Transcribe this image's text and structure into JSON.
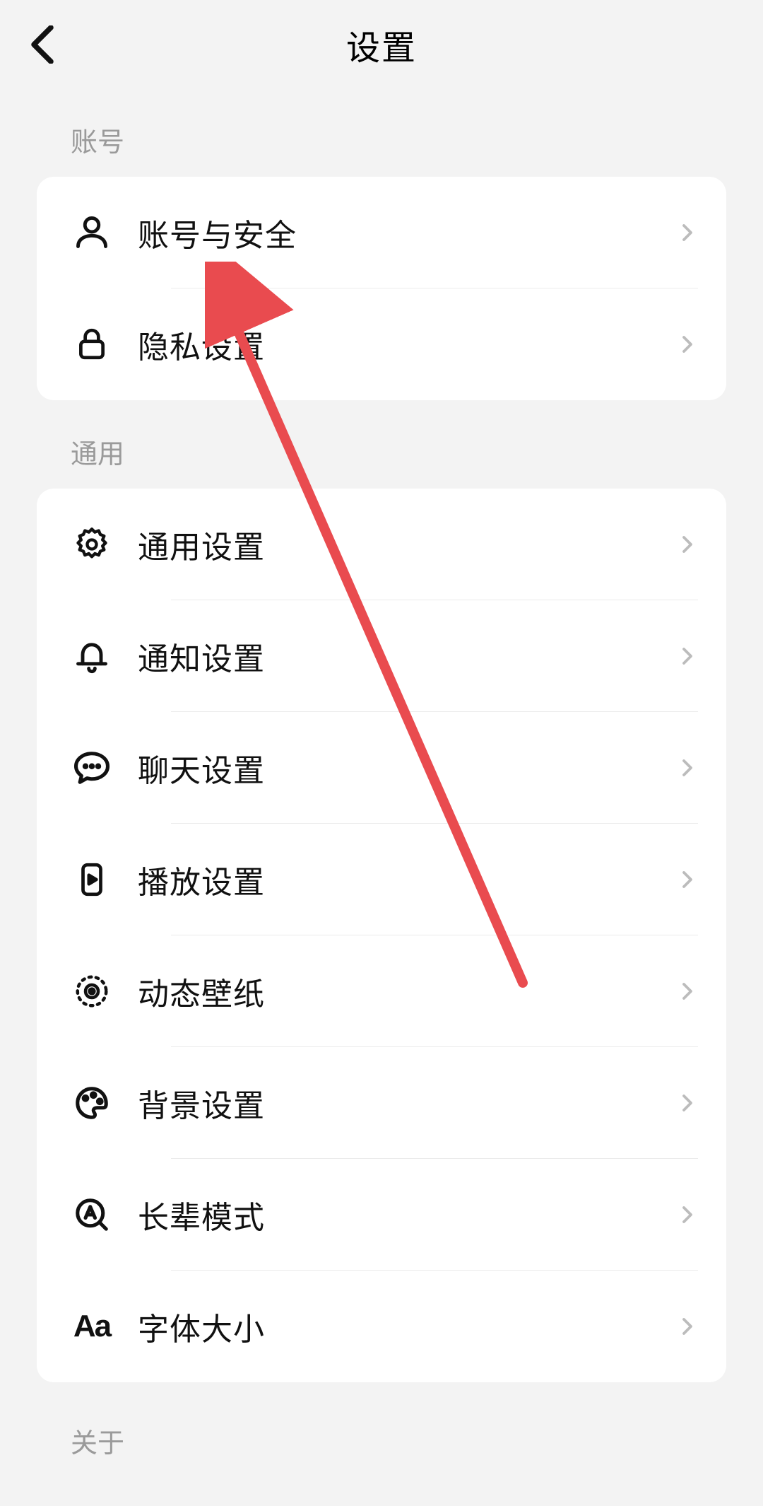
{
  "header": {
    "title": "设置"
  },
  "sections": {
    "account": {
      "label": "账号",
      "items": [
        {
          "label": "账号与安全"
        },
        {
          "label": "隐私设置"
        }
      ]
    },
    "general": {
      "label": "通用",
      "items": [
        {
          "label": "通用设置"
        },
        {
          "label": "通知设置"
        },
        {
          "label": "聊天设置"
        },
        {
          "label": "播放设置"
        },
        {
          "label": "动态壁纸"
        },
        {
          "label": "背景设置"
        },
        {
          "label": "长辈模式"
        },
        {
          "label": "字体大小"
        }
      ]
    },
    "about": {
      "label": "关于"
    }
  },
  "colors": {
    "annotation_arrow": "#e94b4f"
  }
}
